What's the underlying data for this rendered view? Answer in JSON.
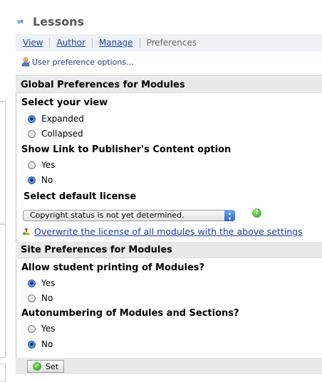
{
  "header": {
    "title": "Lessons"
  },
  "nav": {
    "view": "View",
    "author": "Author",
    "manage": "Manage",
    "preferences": "Preferences"
  },
  "user_pref_link": "User preference options...",
  "global": {
    "heading": "Global Preferences for Modules",
    "view_label": "Select your view",
    "view_options": [
      "Expanded",
      "Collapsed"
    ],
    "view_selected": "Expanded",
    "publisher_label": "Show Link to Publisher's Content option",
    "publisher_options": [
      "Yes",
      "No"
    ],
    "publisher_selected": "No",
    "license_label": "Select default license",
    "license_value": "Copyright status is not yet determined.",
    "overwrite_link": "Overwrite the license of all modules with the above settings"
  },
  "site": {
    "heading": "Site Preferences for Modules",
    "printing_label": "Allow student printing of Modules?",
    "printing_options": [
      "Yes",
      "No"
    ],
    "printing_selected": "Yes",
    "autonumber_label": "Autonumbering of Modules and Sections?",
    "autonumber_options": [
      "Yes",
      "No"
    ],
    "autonumber_selected": "No"
  },
  "set_button": "Set",
  "colors": {
    "link": "#1a44a8",
    "section_bg": "#e9e9e9",
    "nav_bg": "#eef1f6"
  }
}
